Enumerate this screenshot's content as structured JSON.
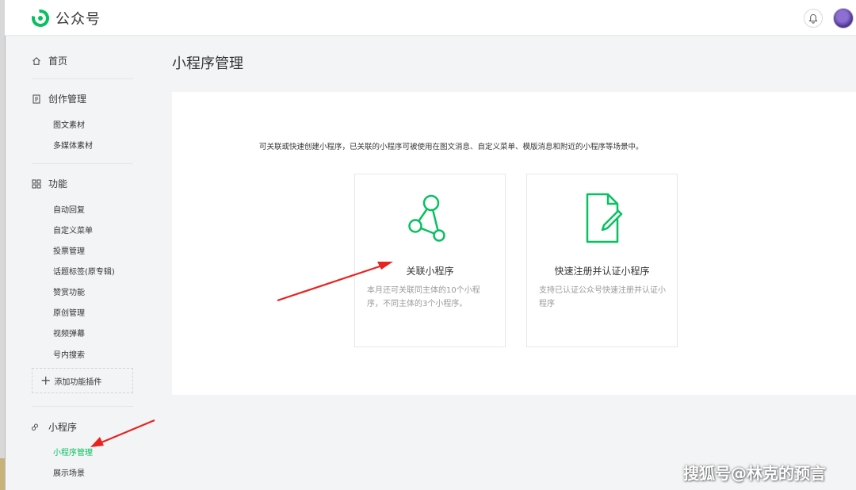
{
  "brand": {
    "name": "公众号",
    "logo_icon": "wechat-official-logo",
    "accent": "#07c160"
  },
  "topbar": {
    "bell_icon": "bell-icon"
  },
  "sidebar": {
    "home": "首页",
    "creation": {
      "title": "创作管理",
      "items": [
        "图文素材",
        "多媒体素材"
      ]
    },
    "features": {
      "title": "功能",
      "items": [
        "自动回复",
        "自定义菜单",
        "投票管理",
        "话题标签(原专辑)",
        "赞赏功能",
        "原创管理",
        "视频弹幕",
        "号内搜索"
      ]
    },
    "add_plugin": "添加功能插件",
    "miniprogram": {
      "title": "小程序",
      "items": [
        "小程序管理",
        "展示场景"
      ],
      "active_index": 0
    }
  },
  "main": {
    "title": "小程序管理",
    "description": "可关联或快速创建小程序，已关联的小程序可被使用在图文消息、自定义菜单、模版消息和附近的小程序等场景中。",
    "cards": [
      {
        "title": "关联小程序",
        "desc": "本月还可关联同主体的10个小程序，不同主体的3个小程序。",
        "icon": "link-nodes-icon"
      },
      {
        "title": "快速注册并认证小程序",
        "desc": "支持已认证公众号快速注册并认证小程序",
        "icon": "document-edit-icon"
      }
    ]
  },
  "annotation_color": "#e8231f",
  "watermark": "搜狐号@林克的预言"
}
